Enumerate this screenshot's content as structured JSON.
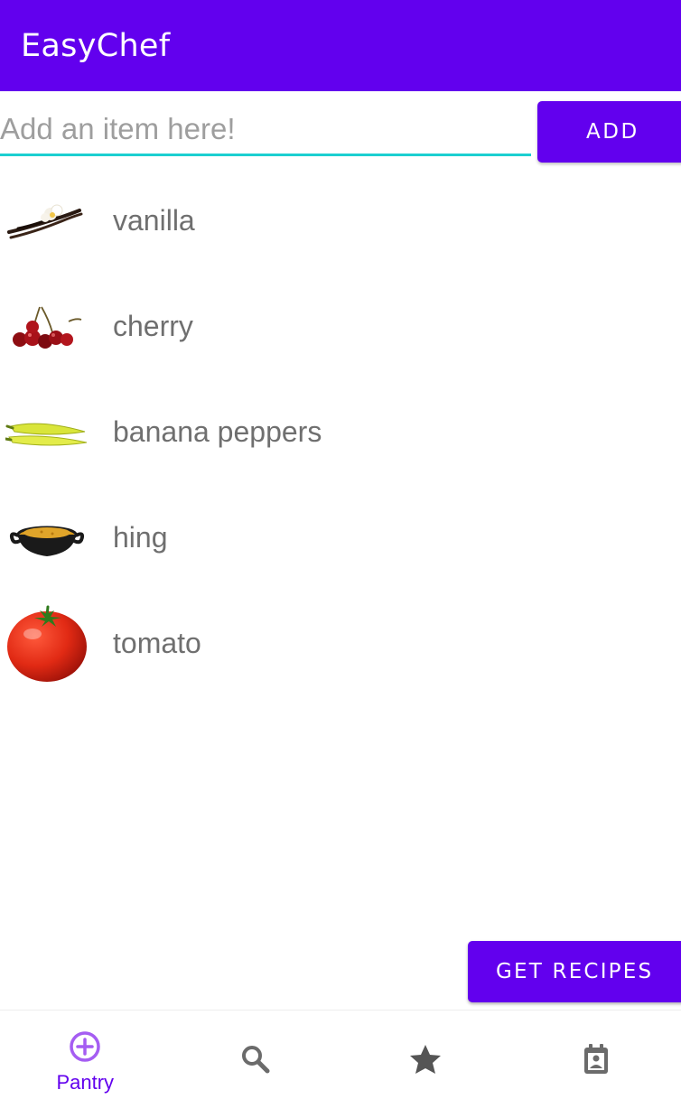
{
  "app_bar": {
    "title": "EasyChef"
  },
  "add_form": {
    "placeholder": "Add an item here!",
    "value": "",
    "add_label": "ADD"
  },
  "pantry": {
    "items": [
      {
        "label": "vanilla",
        "icon": "vanilla-image"
      },
      {
        "label": "cherry",
        "icon": "cherry-image"
      },
      {
        "label": "banana peppers",
        "icon": "banana-peppers-image"
      },
      {
        "label": "hing",
        "icon": "hing-image"
      },
      {
        "label": "tomato",
        "icon": "tomato-image"
      }
    ]
  },
  "actions": {
    "get_recipes_label": "GET RECIPES"
  },
  "bottom_nav": {
    "tabs": [
      {
        "label": "Pantry",
        "icon": "add-circle-icon",
        "selected": true
      },
      {
        "label": "",
        "icon": "search-icon",
        "selected": false
      },
      {
        "label": "",
        "icon": "star-icon",
        "selected": false
      },
      {
        "label": "",
        "icon": "calendar-person-icon",
        "selected": false
      }
    ]
  },
  "colors": {
    "primary": "#6200ee",
    "accent_underline": "#1ccfd0",
    "text_secondary": "#6f6f6f",
    "icon_inactive": "#5f5f5f"
  }
}
